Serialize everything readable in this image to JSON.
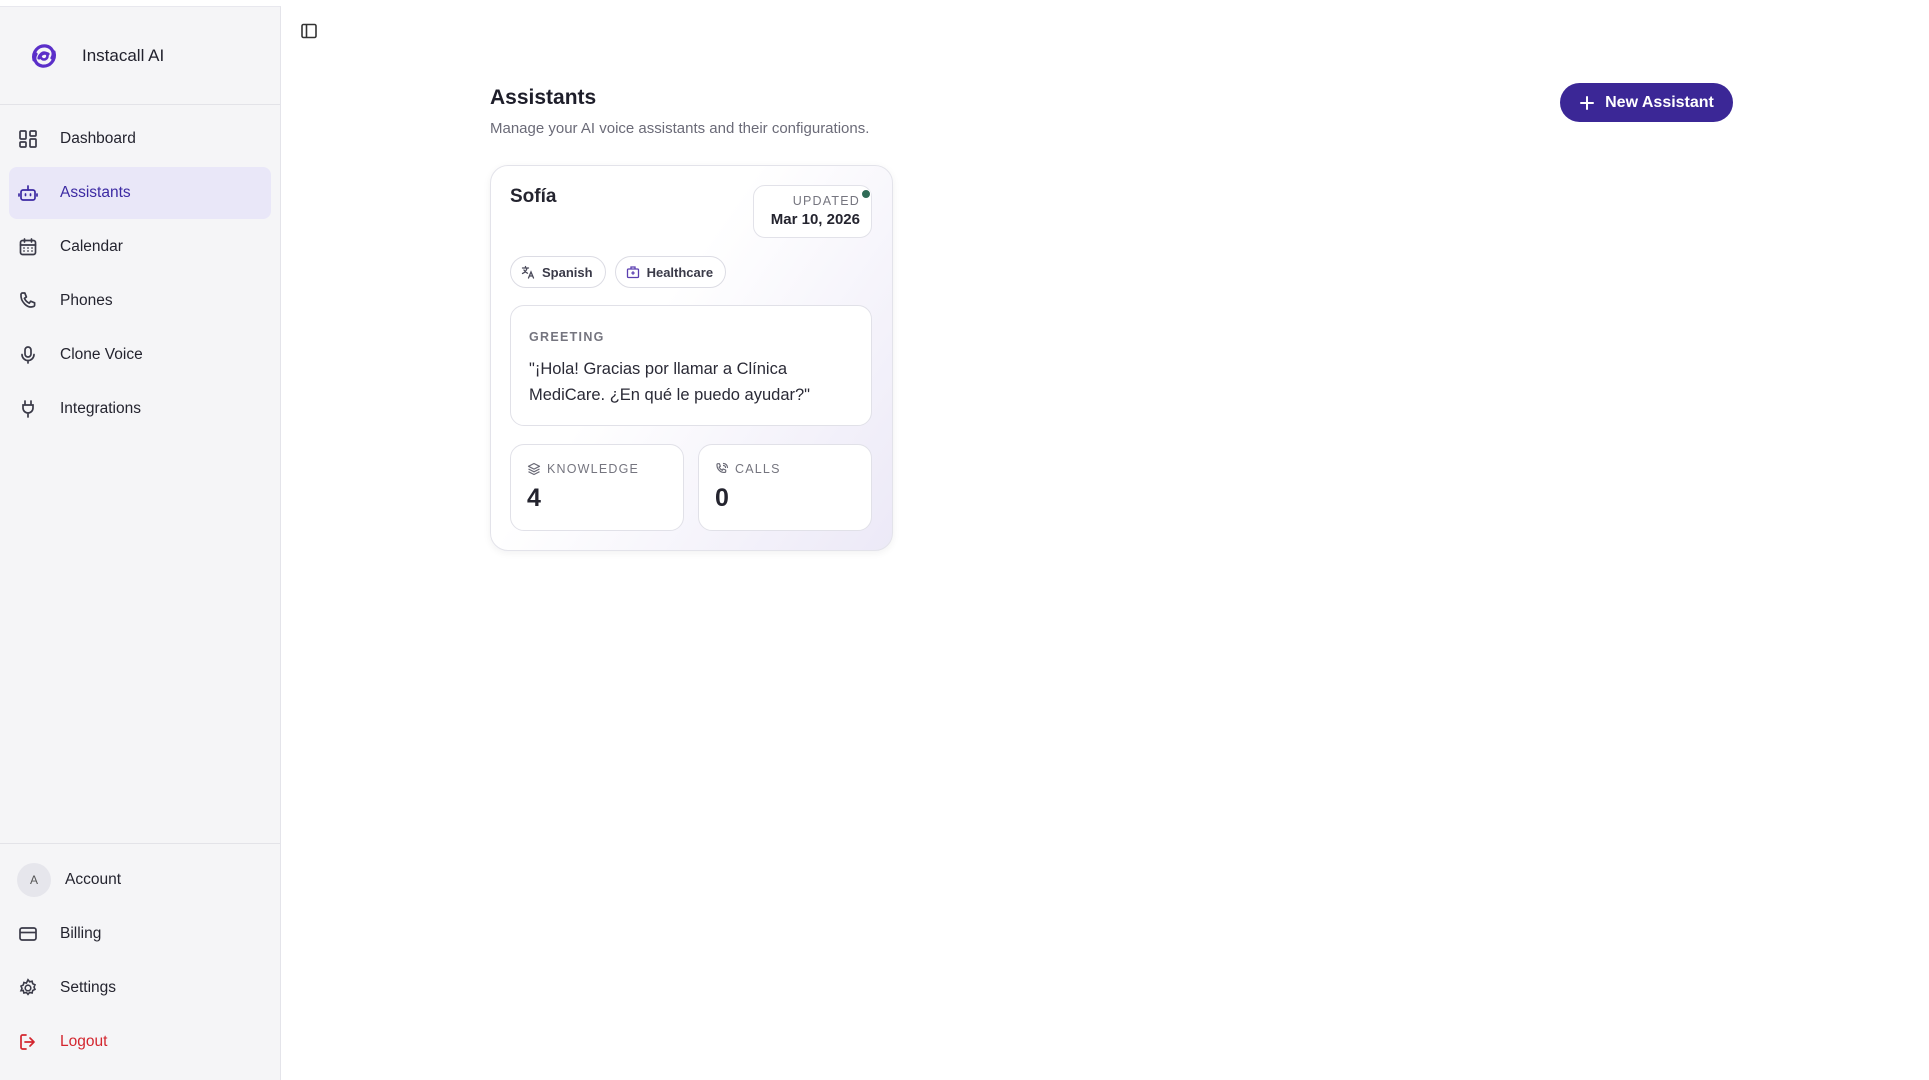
{
  "app": {
    "name": "Instacall AI"
  },
  "sidebar": {
    "items": [
      {
        "label": "Dashboard",
        "icon": "dashboard-icon"
      },
      {
        "label": "Assistants",
        "icon": "bot-icon",
        "active": true
      },
      {
        "label": "Calendar",
        "icon": "calendar-icon"
      },
      {
        "label": "Phones",
        "icon": "phone-icon"
      },
      {
        "label": "Clone Voice",
        "icon": "microphone-icon"
      },
      {
        "label": "Integrations",
        "icon": "plug-icon"
      }
    ],
    "bottom": {
      "account": {
        "label": "Account",
        "avatar_initial": "A"
      },
      "billing": {
        "label": "Billing",
        "icon": "credit-card-icon"
      },
      "settings": {
        "label": "Settings",
        "icon": "gear-icon"
      },
      "logout": {
        "label": "Logout",
        "icon": "logout-icon"
      }
    }
  },
  "header": {
    "title": "Assistants",
    "subtitle": "Manage your AI voice assistants and their configurations.",
    "new_button_label": "New Assistant"
  },
  "assistant_card": {
    "name": "Sofía",
    "updated_label": "UPDATED",
    "updated_date": "Mar 10, 2026",
    "status_color": "#2f6b56",
    "tags": [
      {
        "label": "Spanish",
        "icon": "translate-icon"
      },
      {
        "label": "Healthcare",
        "icon": "hospital-icon"
      }
    ],
    "greeting_label": "GREETING",
    "greeting_text": "\"¡Hola! Gracias por llamar a Clínica MediCare. ¿En qué le puedo ayudar?\"",
    "stats": {
      "knowledge": {
        "label": "KNOWLEDGE",
        "value": "4",
        "icon": "layers-icon"
      },
      "calls": {
        "label": "CALLS",
        "value": "0",
        "icon": "phone-call-icon"
      }
    }
  },
  "colors": {
    "accent": "#3b2796",
    "active_nav_bg": "#e9e7f8",
    "logout": "#d3262f"
  }
}
